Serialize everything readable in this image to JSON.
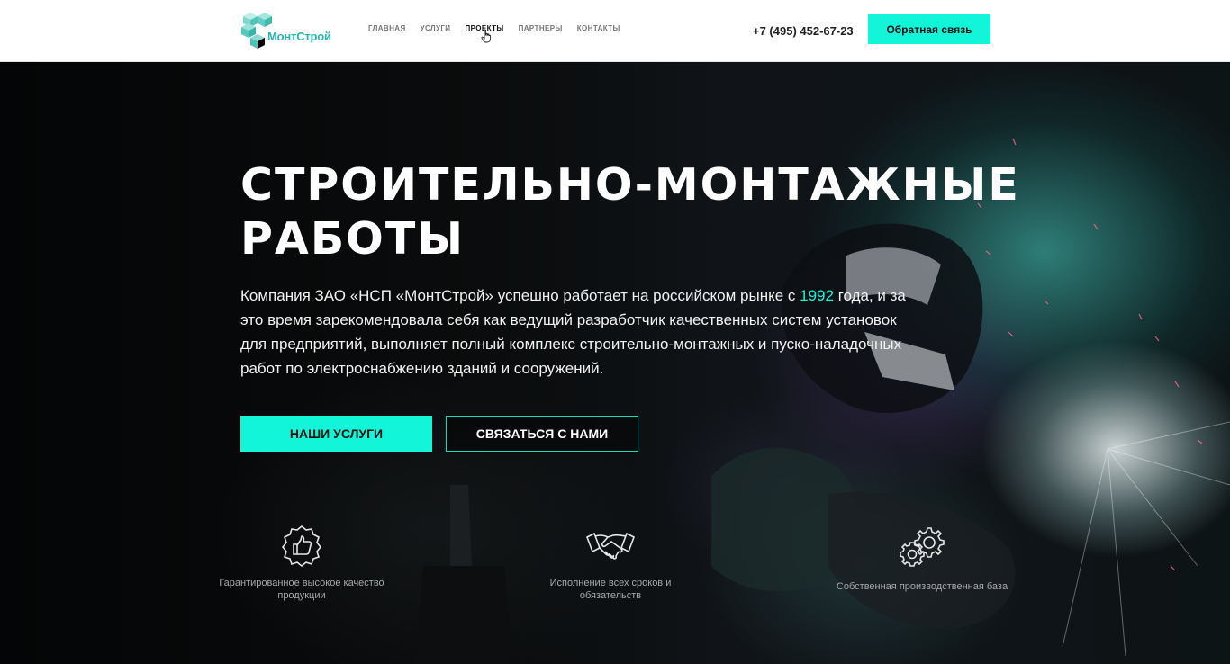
{
  "header": {
    "logo_text": "МонтСтрой",
    "nav": [
      "ГЛАВНАЯ",
      "УСЛУГИ",
      "ПРОЕКТЫ",
      "ПАРТНЕРЫ",
      "КОНТАКТЫ"
    ],
    "active_nav": "ПРОЕКТЫ",
    "phone": "+7 (495) 452-67-23",
    "callback_label": "Обратная связь"
  },
  "hero": {
    "title_line1": "СТРОИТЕЛЬНО-МОНТАЖНЫЕ",
    "title_line2": "РАБОТЫ",
    "text_before_year": "Компания ЗАО «НСП «МонтСтрой» успешно работает на российском рынке с ",
    "year": "1992",
    "text_after_year": " года, и за это время зарекомендовала себя как ведущий разработчик качественных систем установок для предприятий, выполняет полный комплекс строительно-монтажных и пуско-наладочных работ по электроснабжению зданий и сооружений.",
    "btn_services": "НАШИ УСЛУГИ",
    "btn_contact": "СВЯЗАТЬСЯ С НАМИ"
  },
  "features": [
    {
      "icon": "thumbs-up-badge-icon",
      "text": "Гарантированное высокое качество продукции"
    },
    {
      "icon": "handshake-icon",
      "text": "Исполнение всех сроков и обязательств"
    },
    {
      "icon": "gears-icon",
      "text": "Собственная производственная база"
    }
  ],
  "colors": {
    "accent": "#12f5d8",
    "logo": "#2ab7b0"
  }
}
